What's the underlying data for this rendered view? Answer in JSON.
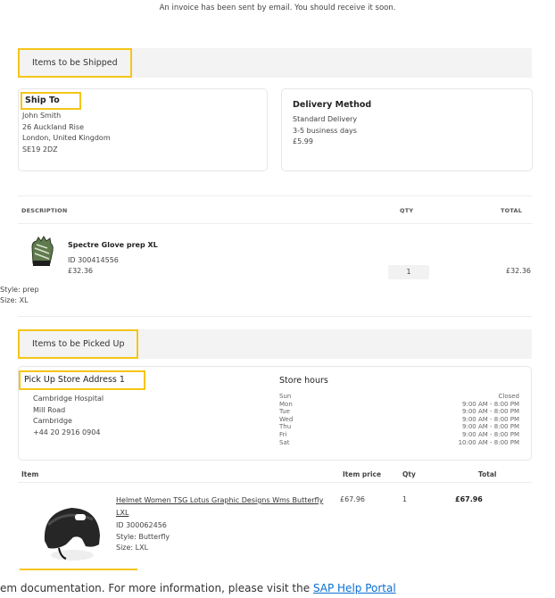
{
  "notice": "An invoice has been sent by email. You should receive it soon.",
  "shipped": {
    "section_label": "Items to be Shipped",
    "ship_to": {
      "title": "Ship To",
      "name": "John Smith",
      "street": "26 Auckland Rise",
      "city": "London, United Kingdom",
      "postcode": "SE19 2DZ"
    },
    "delivery": {
      "title": "Delivery Method",
      "method": "Standard Delivery",
      "time": "3-5 business days",
      "price": "£5.99"
    },
    "columns": {
      "description": "DESCRIPTION",
      "qty": "QTY",
      "total": "TOTAL"
    },
    "item": {
      "name": "Spectre Glove prep XL",
      "id": "ID 300414556",
      "price": "£32.36",
      "qty": "1",
      "total": "£32.36",
      "style": "Style: prep",
      "size": "Size: XL"
    }
  },
  "pickup": {
    "section_label": "Items to be Picked Up",
    "store": {
      "title": "Pick Up Store Address 1",
      "lines": [
        "Cambridge Hospital",
        "Mill Road",
        "Cambridge",
        "+44 20 2916 0904"
      ]
    },
    "hours": {
      "title": "Store hours",
      "days": [
        "Sun",
        "Mon",
        "Tue",
        "Wed",
        "Thu",
        "Fri",
        "Sat"
      ],
      "times": [
        "Closed",
        "9:00 AM - 8:00 PM",
        "9:00 AM - 8:00 PM",
        "9:00 AM - 8:00 PM",
        "9:00 AM - 8:00 PM",
        "9:00 AM - 8:00 PM",
        "10:00 AM - 8:00 PM"
      ]
    },
    "columns": {
      "item": "Item",
      "price": "Item price",
      "qty": "Qty",
      "total": "Total"
    },
    "item": {
      "name_line1": "Helmet Women TSG Lotus Graphic Designs Wms Butterfly",
      "name_line2": "LXL",
      "id": "ID 300062456",
      "style": "Style: Butterfly",
      "size": "Size: LXL",
      "price": "£67.96",
      "qty": "1",
      "total": "£67.96"
    }
  },
  "help": {
    "text": "em documentation. For more information, please visit the ",
    "link": "SAP Help Portal"
  },
  "colors": {
    "highlight": "#f5c518",
    "section_bg": "#f3f3f3",
    "link": "#0a6ed1"
  }
}
